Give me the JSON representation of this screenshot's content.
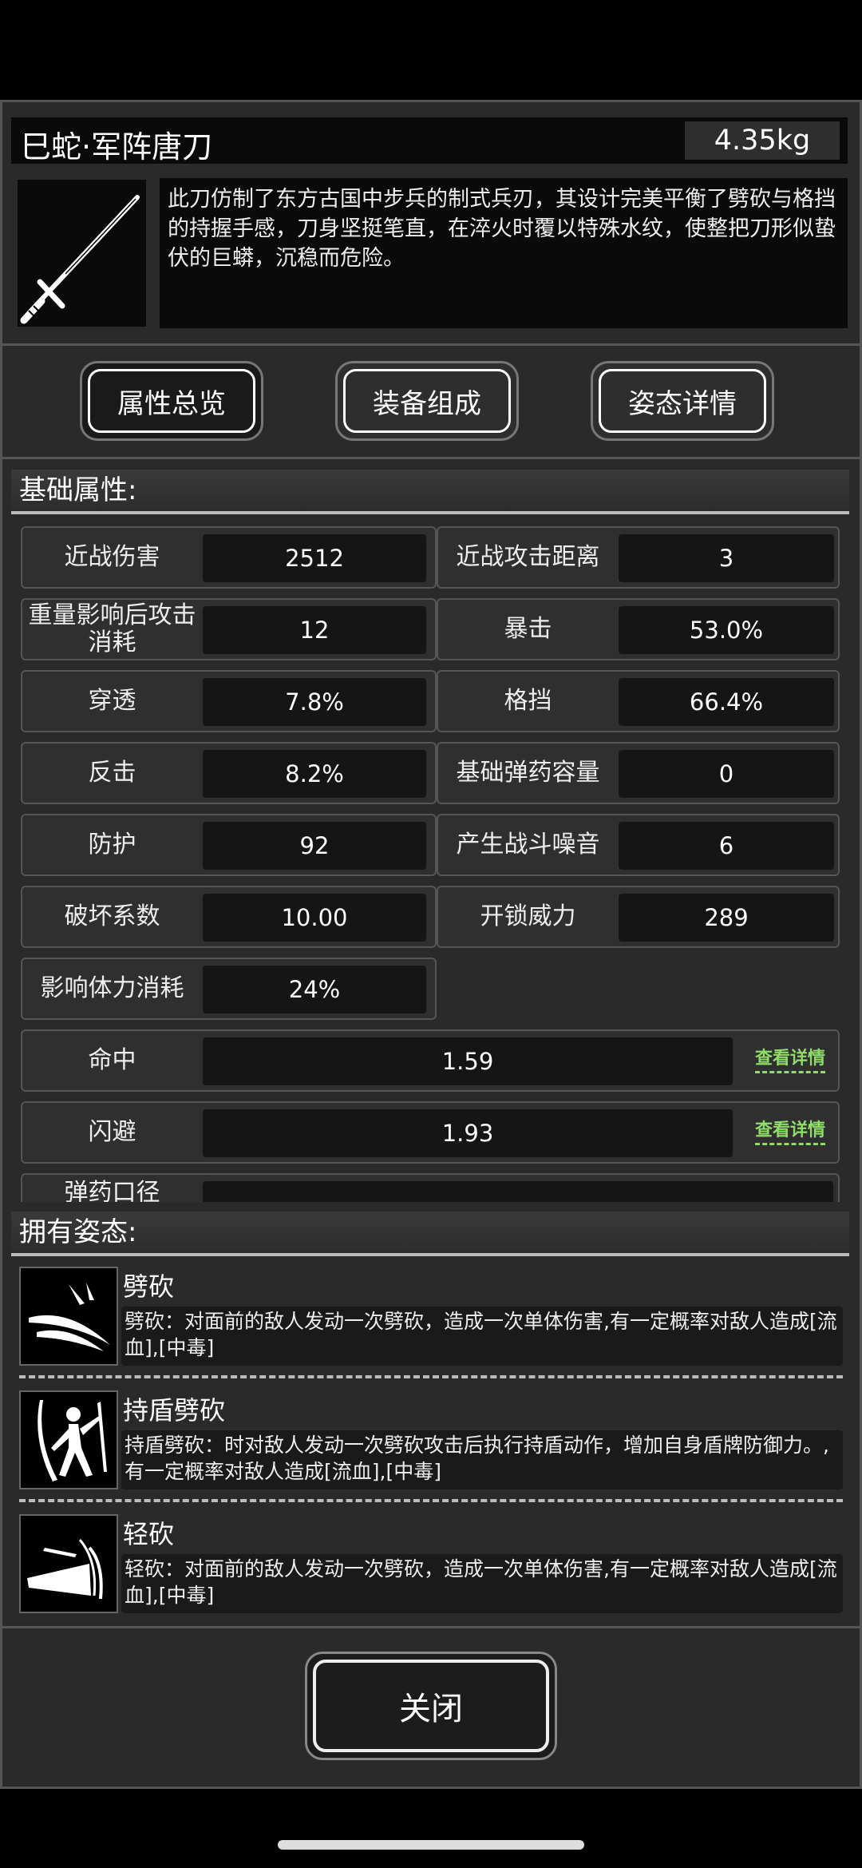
{
  "item": {
    "title": "巳蛇·军阵唐刀",
    "weight": "4.35kg",
    "icon": "sword-icon",
    "description": "此刀仿制了东方古国中步兵的制式兵刃，其设计完美平衡了劈砍与格挡的持握手感，刀身坚挺笔直，在淬火时覆以特殊水纹，使整把刀形似蛰伏的巨蟒，沉稳而危险。"
  },
  "tabs": [
    {
      "label": "属性总览"
    },
    {
      "label": "装备组成"
    },
    {
      "label": "姿态详情"
    }
  ],
  "basic": {
    "header": "基础属性:",
    "stats": [
      {
        "label": "近战伤害",
        "value": "2512"
      },
      {
        "label": "近战攻击距离",
        "value": "3"
      },
      {
        "label": "重量影响后攻击消耗",
        "value": "12"
      },
      {
        "label": "暴击",
        "value": "53.0%"
      },
      {
        "label": "穿透",
        "value": "7.8%"
      },
      {
        "label": "格挡",
        "value": "66.4%"
      },
      {
        "label": "反击",
        "value": "8.2%"
      },
      {
        "label": "基础弹药容量",
        "value": "0"
      },
      {
        "label": "防护",
        "value": "92"
      },
      {
        "label": "产生战斗噪音",
        "value": "6"
      },
      {
        "label": "破坏系数",
        "value": "10.00"
      },
      {
        "label": "开锁威力",
        "value": "289"
      },
      {
        "label": "影响体力消耗",
        "value": "24%"
      }
    ],
    "wide_stats": [
      {
        "label": "命中",
        "value": "1.59",
        "link": "查看详情"
      },
      {
        "label": "闪避",
        "value": "1.93",
        "link": "查看详情"
      },
      {
        "label": "弹药口径",
        "value": ""
      }
    ]
  },
  "stances": {
    "header": "拥有姿态:",
    "items": [
      {
        "name": "劈砍",
        "icon": "slash-icon",
        "desc": "劈砍：对面前的敌人发动一次劈砍，造成一次单体伤害,有一定概率对敌人造成[流血],[中毒]"
      },
      {
        "name": "持盾劈砍",
        "icon": "shield-slash-icon",
        "desc": "持盾劈砍：时对敌人发动一次劈砍攻击后执行持盾动作，增加自身盾牌防御力。,有一定概率对敌人造成[流血],[中毒]"
      },
      {
        "name": "轻砍",
        "icon": "light-slash-icon",
        "desc": "轻砍：对面前的敌人发动一次劈砍，造成一次单体伤害,有一定概率对敌人造成[流血],[中毒]"
      }
    ]
  },
  "close_label": "关闭"
}
